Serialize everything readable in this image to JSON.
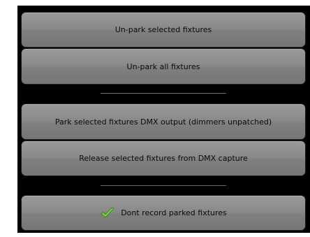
{
  "park_panel": {
    "buttons": [
      {
        "label": "Un-park selected fixtures"
      },
      {
        "label": "Un-park all fixtures"
      },
      {
        "label": "Park selected fixtures DMX output (dimmers unpatched)"
      },
      {
        "label": "Release selected fixtures from DMX capture"
      },
      {
        "label": "Dont record parked fixtures",
        "checked": true,
        "icon": "checkmark-icon"
      }
    ]
  },
  "colors": {
    "panel_background": "#000000",
    "button_face": "#8a8a8a",
    "check_green": "#5fbf2a"
  }
}
